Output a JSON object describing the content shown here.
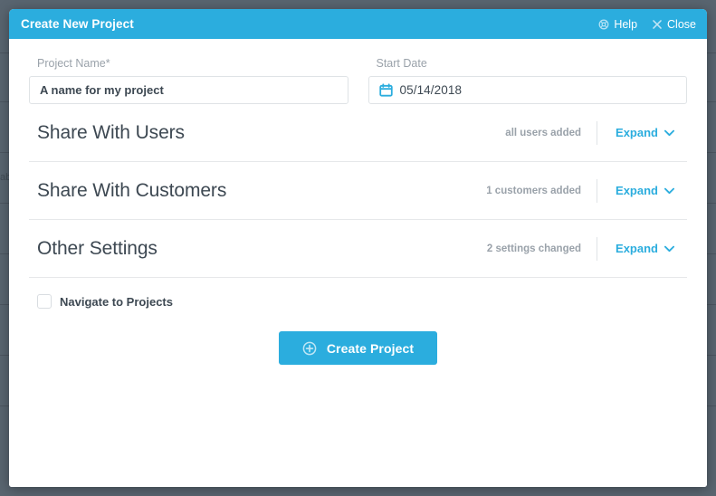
{
  "colors": {
    "accent": "#2badde",
    "backdrop": "#596570",
    "text_dark": "#3d4852",
    "text_muted": "#9aa2aa",
    "divider": "#e6e8ea"
  },
  "header": {
    "title": "Create New Project",
    "actions": [
      {
        "label": "Help",
        "icon": "life-ring-icon"
      },
      {
        "label": "Close",
        "icon": "close-icon"
      }
    ]
  },
  "form": {
    "project_name": {
      "label": "Project Name",
      "required_marker": "*",
      "value": "A name for my project",
      "placeholder": "A name for my project"
    },
    "start_date": {
      "label": "Start Date",
      "value": "05/14/2018",
      "icon": "calendar-icon"
    }
  },
  "sections": [
    {
      "title": "Share With Users",
      "status": "all users added",
      "action_label": "Expand",
      "action_icon": "chevron-down-icon"
    },
    {
      "title": "Share With Customers",
      "status": "1 customers added",
      "action_label": "Expand",
      "action_icon": "chevron-down-icon"
    },
    {
      "title": "Other Settings",
      "status": "2 settings changed",
      "action_label": "Expand",
      "action_icon": "chevron-down-icon"
    }
  ],
  "navigate_checkbox": {
    "label": "Navigate to Projects",
    "checked": false
  },
  "submit": {
    "label": "Create Project",
    "icon": "plus-circle-icon"
  }
}
